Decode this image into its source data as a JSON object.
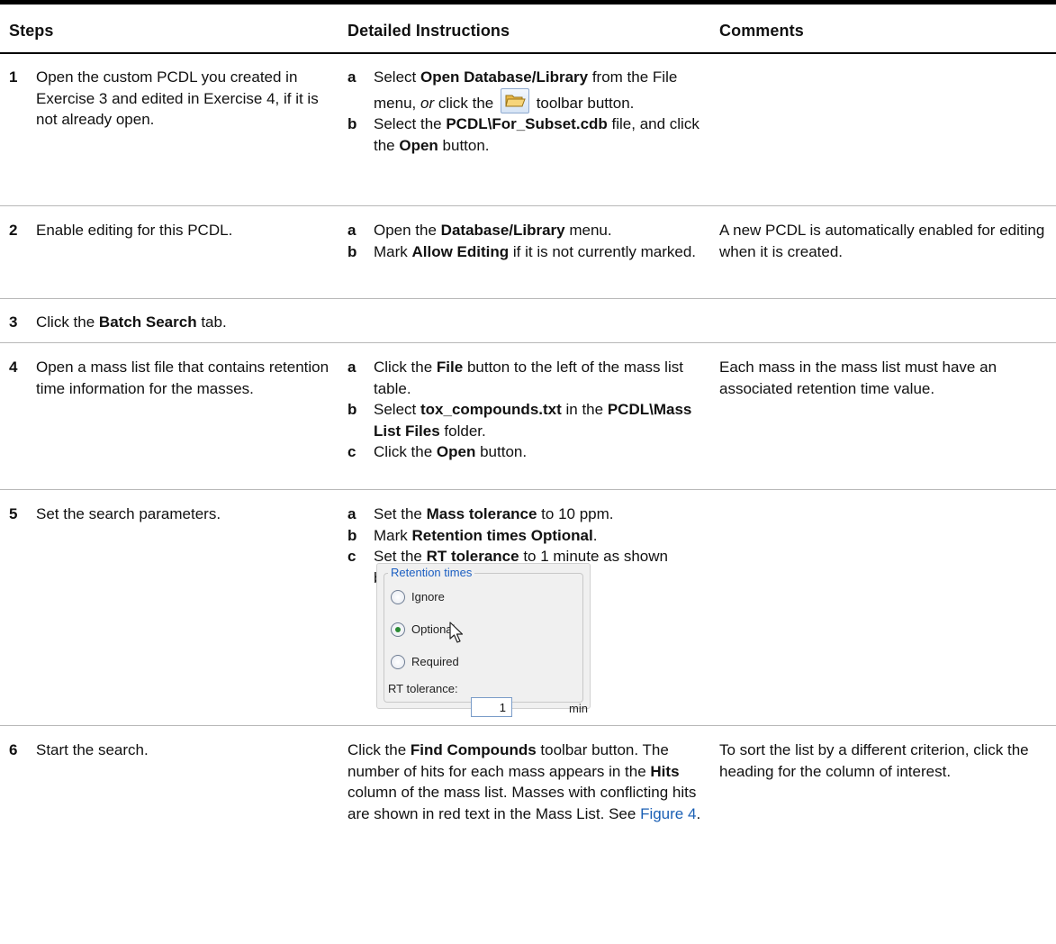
{
  "headers": {
    "steps": "Steps",
    "detailed": "Detailed Instructions",
    "comments": "Comments"
  },
  "rows": [
    {
      "num": "1",
      "step": "Open the custom PCDL you created in Exercise 3 and edited in Exercise 4, if it is not already open.",
      "a": {
        "letter": "a",
        "t1": "Select ",
        "b1": "Open Database/Library",
        "t2": " from the File menu, ",
        "i1": "or",
        "t3": " click the ",
        "t4": " toolbar button."
      },
      "b": {
        "letter": "b",
        "t1": "Select the ",
        "b1": "PCDL\\For_Subset.cdb",
        "t2": " file, and click the ",
        "b2": "Open",
        "t3": " button."
      },
      "comment": ""
    },
    {
      "num": "2",
      "step": "Enable editing for this PCDL.",
      "a": {
        "letter": "a",
        "t1": "Open the ",
        "b1": "Database/Library",
        "t2": " menu."
      },
      "b": {
        "letter": "b",
        "t1": "Mark ",
        "b1": "Allow Editing",
        "t2": " if it is not currently marked."
      },
      "comment": "A new PCDL is automatically enabled for editing when it is created."
    },
    {
      "num": "3",
      "step_t1": "Click the ",
      "step_b1": "Batch Search",
      "step_t2": " tab."
    },
    {
      "num": "4",
      "step": "Open a mass list file that contains retention time information for the masses.",
      "a": {
        "letter": "a",
        "t1": "Click the ",
        "b1": "File",
        "t2": " button to the left of the mass list table."
      },
      "b": {
        "letter": "b",
        "t1": "Select ",
        "b1": "tox_compounds.txt",
        "t2": " in the ",
        "b2": "PCDL\\Mass List Files",
        "t3": " folder."
      },
      "c": {
        "letter": "c",
        "t1": "Click the ",
        "b1": "Open",
        "t2": " button."
      },
      "comment": "Each mass in the mass list must have an associated retention time value."
    },
    {
      "num": "5",
      "step": "Set the search parameters.",
      "a": {
        "letter": "a",
        "t1": "Set the ",
        "b1": "Mass tolerance",
        "t2": " to 10 ppm."
      },
      "b": {
        "letter": "b",
        "t1": "Mark ",
        "b1": "Retention times Optional",
        "t2": "."
      },
      "c": {
        "letter": "c",
        "t1": "Set the ",
        "b1": "RT tolerance",
        "t2": " to 1 minute as shown below:"
      },
      "comment": ""
    },
    {
      "num": "6",
      "step": "Start the search.",
      "d_t1": "Click the ",
      "d_b1": "Find Compounds",
      "d_t2": " toolbar button. The number of hits for each mass appears in the ",
      "d_b2": "Hits",
      "d_t3": " column of the mass list. Masses with conflicting hits are shown in red text in the Mass List. See ",
      "d_link": "Figure 4",
      "d_t4": ".",
      "comment": "To sort the list by a different criterion, click the heading for the column of interest."
    }
  ],
  "rt_panel": {
    "legend": "Retention times",
    "options": [
      "Ignore",
      "Optional",
      "Required"
    ],
    "selected": "Optional",
    "tolerance_label": "RT tolerance:",
    "tolerance_value": "1",
    "unit": "min"
  },
  "colors": {
    "link": "#1a5fb4",
    "legend": "#1c5fc2",
    "radio_dot": "#2a8a34"
  },
  "icons": {
    "toolbar_open": "open-folder-icon",
    "cursor": "mouse-pointer-icon"
  }
}
